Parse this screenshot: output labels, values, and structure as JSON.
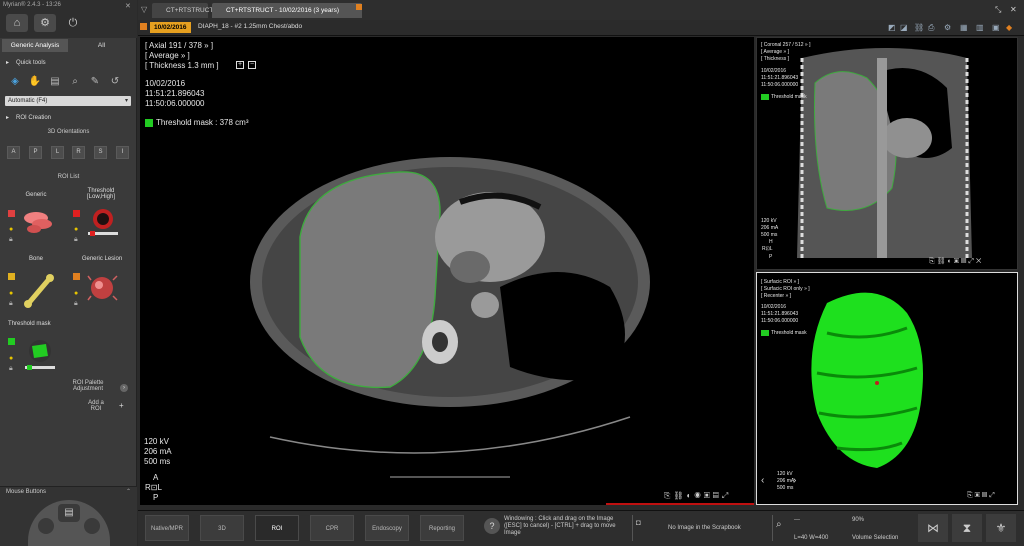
{
  "app": {
    "version": "Myrian® 2.4.3 - 13:26"
  },
  "window_tabs": [
    {
      "label": "CT+RTSTRUCT"
    },
    {
      "label": "CT+RTSTRUCT - 10/02/2016 (3 years)"
    }
  ],
  "series_header": {
    "date": "10/02/2016",
    "title": "DIAPH_18 - #2 1.25mm Chest/abdo"
  },
  "left_panel": {
    "tabs": [
      {
        "label": "Generic Analysis"
      },
      {
        "label": "All"
      }
    ],
    "quick_tools_label": "Quick tools",
    "dropdown_value": "Automatic (F4)",
    "roi_creation_label": "ROI Creation",
    "orientations_label": "3D Orientations",
    "orientations": [
      "A",
      "P",
      "L",
      "R",
      "S",
      "I"
    ],
    "roi_list_label": "ROI List",
    "roi_items": [
      {
        "name": "Generic",
        "color": "#e04040"
      },
      {
        "name": "Threshold\n[Low,High]",
        "color": "#e02020"
      },
      {
        "name": "Bone",
        "color": "#e0b020"
      },
      {
        "name": "Generic Lesion",
        "color": "#e08020"
      },
      {
        "name": "Threshold mask",
        "color": "#22cc22"
      }
    ],
    "palette_label": "ROI Palette\nAdjustment",
    "add_roi_label": "Add a\nROI",
    "mouse_buttons_label": "Mouse Buttons"
  },
  "main_view": {
    "line1": "[ Axial 191 / 378 » ]",
    "line2": "[ Average » ]",
    "line3": "[ Thickness 1.3 mm ]",
    "date": "10/02/2016",
    "time1": "11:51:21.896043",
    "time2": "11:50:06.000000",
    "mask": "Threshold mask : 378 cm³",
    "kv": "120 kV",
    "ma": "206 mA",
    "ms": "500 ms",
    "orient_a": "A",
    "orient_rl": "R⊡L",
    "orient_p": "P"
  },
  "coronal_view": {
    "line1": "[ Coronal 257 / 512 » ]",
    "line2": "[ Average » ]",
    "line3": "[ Thickness ]",
    "date": "10/02/2016",
    "time1": "11:51:21.896043",
    "time2": "11:50:06.000000",
    "mask": "Threshold mask",
    "kv": "120 kV",
    "ma": "206 mA",
    "ms": "500 ms",
    "orient_h": "H",
    "orient_rl": "R⊡L",
    "orient_p": "P"
  },
  "volume_view": {
    "line1": "[ Surfacic ROI » ]",
    "line2": "[ Surfacic ROI only » ]",
    "line3": "[ Recenter » ]",
    "date": "10/02/2016",
    "time1": "11:51:21.896043",
    "time2": "11:50:06.000000",
    "mask": "Threshold mask",
    "kv": "120 kV",
    "ma": "206 mA",
    "ms": "500 ms"
  },
  "bottom_tabs": [
    {
      "label": "Native/MPR"
    },
    {
      "label": "3D"
    },
    {
      "label": "ROI"
    },
    {
      "label": "CPR"
    },
    {
      "label": "Endoscopy"
    },
    {
      "label": "Reporting"
    }
  ],
  "status": {
    "hint": "Windowing : Click and drag on the Image ([ESC] to cancel) - [CTRL] + drag to move Image",
    "scrapbook": "No Image in the Scrapbook",
    "zoom": "90%",
    "window": "L=40 W=400",
    "mode": "Volume Selection",
    "dash": "---"
  }
}
